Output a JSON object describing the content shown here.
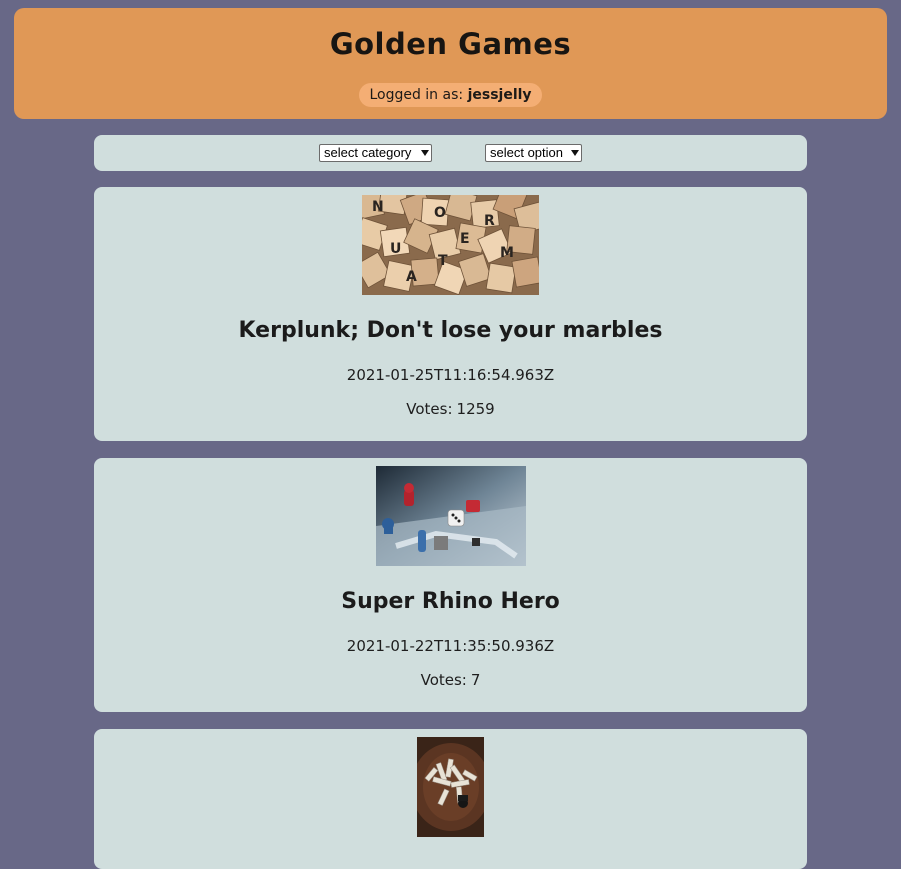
{
  "header": {
    "title": "Golden Games",
    "login_prefix": "Logged in as:",
    "username": "jessjelly"
  },
  "filters": {
    "category_select": {
      "selected": "select category"
    },
    "option_select": {
      "selected": "select option"
    }
  },
  "reviews": [
    {
      "title": "Kerplunk; Don't lose your marbles",
      "created_at": "2021-01-25T11:16:54.963Z",
      "votes_label": "Votes:",
      "votes": "1259",
      "image": "scrabble-tiles-photo"
    },
    {
      "title": "Super Rhino Hero",
      "created_at": "2021-01-22T11:35:50.936Z",
      "votes_label": "Votes:",
      "votes": "7",
      "image": "board-game-pieces-photo"
    },
    {
      "image": "jenga-blocks-photo"
    }
  ],
  "colors": {
    "page_background": "#686887",
    "header_background": "#e09856",
    "login_pill_background": "#f4ae74",
    "card_background": "#d0dedd"
  }
}
